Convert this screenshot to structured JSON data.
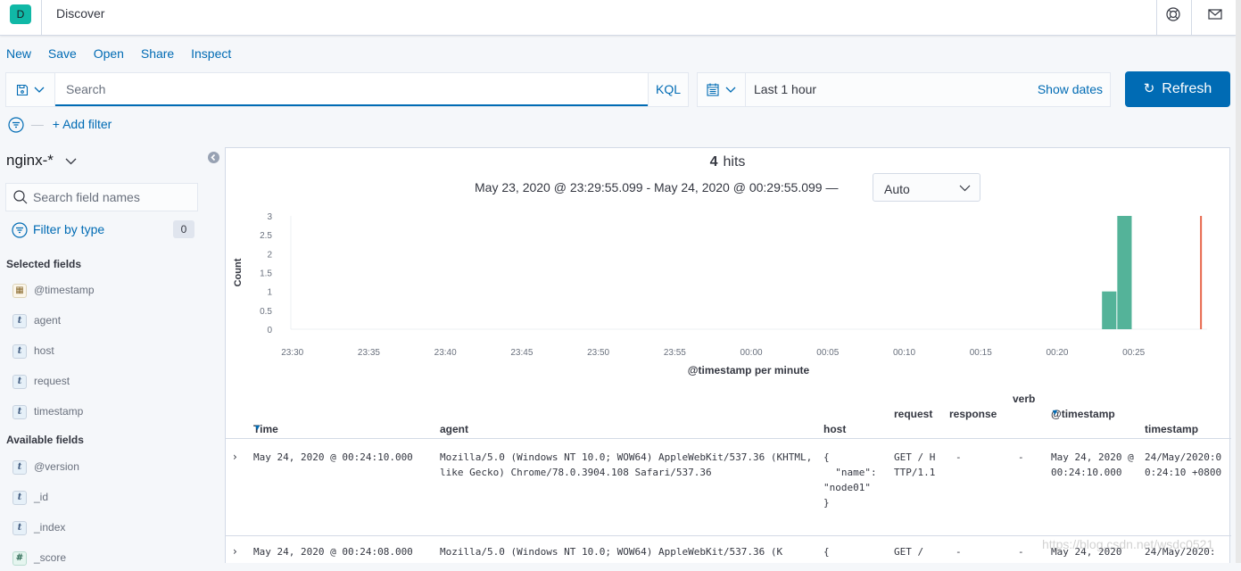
{
  "app": {
    "logo_letter": "D",
    "title": "Discover"
  },
  "header_icons": [
    "help-icon",
    "mail-icon"
  ],
  "menu": [
    "New",
    "Save",
    "Open",
    "Share",
    "Inspect"
  ],
  "query": {
    "placeholder": "Search",
    "value": "",
    "language": "KQL"
  },
  "time": {
    "range": "Last 1 hour",
    "show_dates": "Show dates",
    "refresh": "Refresh"
  },
  "filter": {
    "add_filter": "+ Add filter"
  },
  "sidebar": {
    "index_pattern": "nginx-*",
    "search_placeholder": "Search field names",
    "filter_by_type": "Filter by type",
    "filter_count": "0",
    "selected_title": "Selected fields",
    "selected": [
      {
        "name": "@timestamp",
        "type": "date"
      },
      {
        "name": "agent",
        "type": "t"
      },
      {
        "name": "host",
        "type": "t"
      },
      {
        "name": "request",
        "type": "t"
      },
      {
        "name": "timestamp",
        "type": "t"
      }
    ],
    "available_title": "Available fields",
    "available": [
      {
        "name": "@version",
        "type": "t"
      },
      {
        "name": "_id",
        "type": "t"
      },
      {
        "name": "_index",
        "type": "t"
      },
      {
        "name": "_score",
        "type": "#"
      }
    ]
  },
  "results": {
    "hits_count": "4",
    "hits_label": "hits",
    "date_range": "May 23, 2020 @ 23:29:55.099 - May 24, 2020 @ 00:29:55.099 —",
    "interval": "Auto"
  },
  "chart_data": {
    "type": "bar",
    "title": "",
    "xlabel": "@timestamp per minute",
    "ylabel": "Count",
    "ylim": [
      0,
      3
    ],
    "y_ticks": [
      "0",
      "0.5",
      "1",
      "1.5",
      "2",
      "2.5",
      "3"
    ],
    "x_ticks": [
      "23:30",
      "23:35",
      "23:40",
      "23:45",
      "23:50",
      "23:55",
      "00:00",
      "00:05",
      "00:10",
      "00:15",
      "00:20",
      "00:25"
    ],
    "x_range_minutes": [
      0,
      59.9
    ],
    "bars": [
      {
        "minute_offset": 53.0,
        "label": "00:23",
        "value": 1
      },
      {
        "minute_offset": 54.0,
        "label": "00:24",
        "value": 3
      }
    ],
    "now_marker_minute": 59.5,
    "bar_color": "#54b399",
    "marker_color": "#e7664c"
  },
  "table": {
    "columns": [
      "Time",
      "agent",
      "host",
      "request",
      "response",
      "verb",
      "@timestamp",
      "timestamp"
    ],
    "rows": [
      {
        "time": "May 24, 2020 @ 00:24:10.000",
        "agent": "Mozilla/5.0 (Windows NT 10.0; WOW64) AppleWebKit/537.36 (KHTML, like Gecko) Chrome/78.0.3904.108 Safari/537.36",
        "host": "{\n  \"name\": \"node01\"\n}",
        "request": "GET / HTTP/1.1",
        "response": "-",
        "verb": "-",
        "at_timestamp": "May 24, 2020 @ 00:24:10.000",
        "timestamp": "24/May/2020:00:24:10 +0800"
      },
      {
        "time": "May 24, 2020 @ 00:24:08.000",
        "agent": "Mozilla/5.0 (Windows NT 10.0; WOW64) AppleWebKit/537.36 (K",
        "host": "{",
        "request": "GET /",
        "response": "-",
        "verb": "-",
        "at_timestamp": "May 24, 2020",
        "timestamp": "24/May/2020:"
      }
    ]
  },
  "watermark": "https://blog.csdn.net/wsdc0521"
}
